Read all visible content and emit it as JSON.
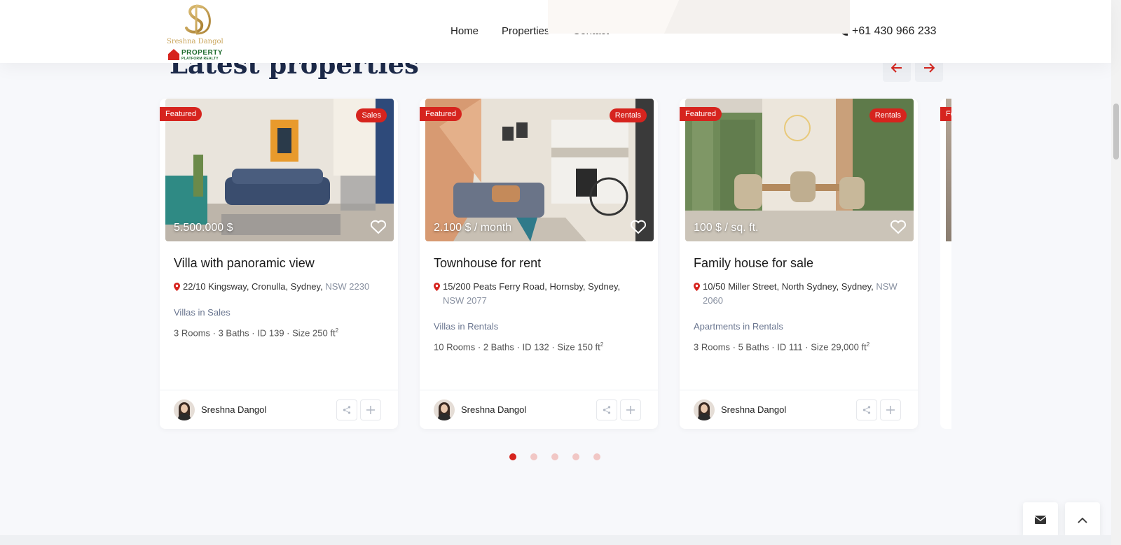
{
  "header": {
    "logo_name": "Sreshna Dangol",
    "logo_property": "PROPERTY",
    "logo_realty": "PLATFORM REALTY",
    "nav": [
      {
        "label": "Home"
      },
      {
        "label": "Properties"
      },
      {
        "label": "Contact"
      }
    ],
    "phone": "+61 430 966 233"
  },
  "section": {
    "title": "Latest properties"
  },
  "colors": {
    "accent": "#d6241e",
    "title": "#1d2a4a"
  },
  "cards": [
    {
      "featured": "Featured",
      "type": "Sales",
      "price": "5.500.000 $",
      "title": "Villa with panoramic view",
      "address": "22/10 Kingsway, Cronulla, Sydney,",
      "address_muted": "NSW 2230",
      "category": "Villas in Sales",
      "specs": [
        "3 Rooms",
        "3 Baths",
        "ID 139",
        "Size 250 ft"
      ],
      "agent": "Sreshna Dangol"
    },
    {
      "featured": "Featured",
      "type": "Rentals",
      "price": "2.100 $ / month",
      "title": "Townhouse for rent",
      "address": "15/200 Peats Ferry Road, Hornsby, Sydney,",
      "address_muted": "NSW 2077",
      "category": "Villas in Rentals",
      "specs": [
        "10 Rooms",
        "2 Baths",
        "ID 132",
        "Size 150 ft"
      ],
      "agent": "Sreshna Dangol"
    },
    {
      "featured": "Featured",
      "type": "Rentals",
      "price": "100 $ / sq. ft.",
      "title": "Family house for sale",
      "address": "10/50 Miller Street, North Sydney, Sydney,",
      "address_muted": "NSW 2060",
      "category": "Apartments in Rentals",
      "specs": [
        "3 Rooms",
        "5 Baths",
        "ID 111",
        "Size 29,000 ft"
      ],
      "agent": "Sreshna Dangol"
    }
  ],
  "partial_card": {
    "featured": "Featured"
  },
  "pagination": {
    "active": 1
  },
  "icons": {
    "phone": "phone-icon",
    "arrow_prev": "arrow-left-icon",
    "arrow_next": "arrow-right-icon",
    "heart": "heart-icon",
    "pin": "map-pin-icon",
    "share": "share-icon",
    "add": "plus-icon",
    "mail": "mail-icon",
    "up": "chevron-up-icon"
  }
}
